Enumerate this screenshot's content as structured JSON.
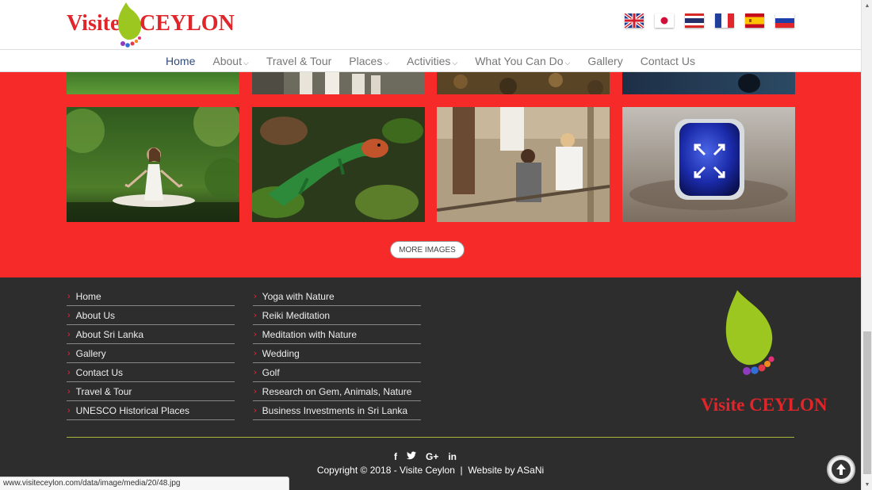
{
  "header": {
    "logo_text_a": "Visite",
    "logo_text_b": "CEYLON",
    "flags": [
      "uk-flag",
      "japan-flag",
      "thailand-flag",
      "france-flag",
      "spain-flag",
      "russia-flag"
    ]
  },
  "nav": {
    "items": [
      {
        "label": "Home",
        "active": true,
        "dropdown": false
      },
      {
        "label": "About",
        "dropdown": true
      },
      {
        "label": "Travel & Tour",
        "dropdown": false
      },
      {
        "label": "Places",
        "dropdown": true
      },
      {
        "label": "Activities",
        "dropdown": true
      },
      {
        "label": "What You Can Do",
        "dropdown": true
      },
      {
        "label": "Gallery",
        "dropdown": false
      },
      {
        "label": "Contact Us",
        "dropdown": false
      }
    ],
    "dropdown_glyph": "⌵"
  },
  "gallery": {
    "more_button": "MORE IMAGES",
    "tiles_top": [
      "grass-image",
      "ceremony-image",
      "forest-floor-image",
      "night-image"
    ],
    "tiles": [
      "meditation-image",
      "lizard-image",
      "gem-mining-image",
      "sapphire-ring-image"
    ],
    "expand_icon": "expand-icon"
  },
  "footer": {
    "col1": [
      "Home",
      "About Us",
      "About Sri Lanka",
      "Gallery",
      "Contact Us",
      "Travel & Tour",
      "UNESCO Historical Places"
    ],
    "col2": [
      "Yoga with Nature",
      "Reiki Meditation",
      "Meditation with Nature",
      "Wedding",
      "Golf",
      "Research on Gem, Animals, Nature",
      "Business Investments in Sri Lanka"
    ],
    "arrow": "›",
    "logo_text_a": "Visite",
    "logo_text_b": "CEYLON",
    "social": [
      "f",
      "t",
      "G+",
      "in"
    ],
    "copyright": "Copyright © 2018 - Visite Ceylon  |  Website by ASaNi"
  },
  "status_url": "www.visiteceylon.com/data/image/media/20/48.jpg",
  "colors": {
    "brand_red": "#e0262b",
    "brand_green": "#9cc721",
    "gallery_bg": "#f72a2a",
    "footer_bg": "#2d2d2d"
  }
}
